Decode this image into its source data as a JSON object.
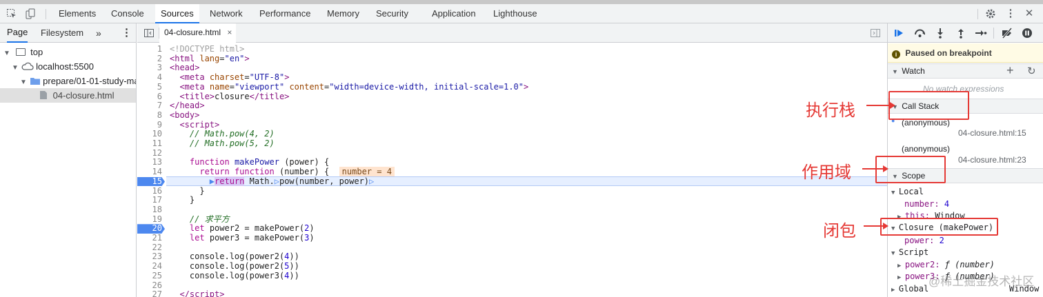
{
  "toolbar": {
    "tabs": [
      "Elements",
      "Console",
      "Sources",
      "Network",
      "Performance",
      "Memory",
      "Security",
      "Application",
      "Lighthouse"
    ],
    "active_tab": "Sources"
  },
  "navigator": {
    "tabs": [
      "Page",
      "Filesystem"
    ],
    "more": "»",
    "menu": "⋮",
    "tree": [
      {
        "label": "top"
      },
      {
        "label": "localhost:5500"
      },
      {
        "label": "prepare/01-01-study-ma"
      },
      {
        "label": "04-closure.html"
      }
    ]
  },
  "editor": {
    "file_tab": "04-closure.html",
    "close": "×"
  },
  "debugger": {
    "paused": "Paused on breakpoint",
    "watch": {
      "title": "Watch",
      "empty": "No watch expressions",
      "add": "+",
      "refresh": "↻"
    },
    "callstack": {
      "title": "Call Stack",
      "frames": [
        {
          "name": "(anonymous)",
          "loc": "04-closure.html:15"
        },
        {
          "name": "(anonymous)",
          "loc": "04-closure.html:23"
        }
      ]
    },
    "scope": {
      "title": "Scope",
      "local": "Local",
      "local_number_key": "number:",
      "local_number_val": "4",
      "local_this_key": "this:",
      "local_this_val": "Window",
      "closure": "Closure (makePower)",
      "closure_power_key": "power:",
      "closure_power_val": "2",
      "script": "Script",
      "script_power2_key": "power2:",
      "script_power2_val": "ƒ (number)",
      "script_power3_key": "power3:",
      "script_power3_val": "ƒ (number)",
      "global": "Global",
      "global_val": "Window"
    }
  },
  "annotations": {
    "callstack": "执行栈",
    "scope": "作用域",
    "closure": "闭包"
  },
  "watermark": "@稀土掘金技术社区",
  "colors": {
    "annotation": "#e53935",
    "accent": "#1a73e8",
    "breakpoint": "#4d88ef"
  }
}
